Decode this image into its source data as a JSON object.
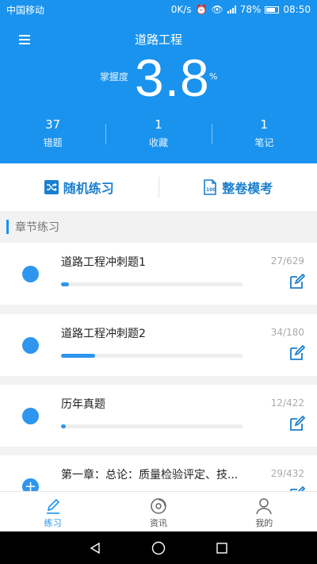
{
  "status_bar": {
    "carrier": "中国移动",
    "speed": "0K/s",
    "battery": "78%",
    "time": "08:50"
  },
  "header": {
    "title": "道路工程",
    "mastery_label": "掌握度",
    "mastery_value": "3.8",
    "mastery_unit": "%",
    "stats": [
      {
        "value": "37",
        "label": "错题"
      },
      {
        "value": "1",
        "label": "收藏"
      },
      {
        "value": "1",
        "label": "笔记"
      }
    ]
  },
  "quick_actions": {
    "random_label": "随机练习",
    "exam_label": "整卷模考"
  },
  "section": {
    "title": "章节练习"
  },
  "chapters": [
    {
      "title": "道路工程冲刺题1",
      "count": "27/629",
      "progress": 0.043,
      "marker": ""
    },
    {
      "title": "道路工程冲刺题2",
      "count": "34/180",
      "progress": 0.189,
      "marker": ""
    },
    {
      "title": "历年真题",
      "count": "12/422",
      "progress": 0.028,
      "marker": ""
    },
    {
      "title": "第一章：总论：质量检验评定、技...",
      "count": "29/432",
      "progress": 0.067,
      "marker": "+"
    }
  ],
  "bottom_nav": [
    {
      "label": "练习",
      "active": true
    },
    {
      "label": "资讯",
      "active": false
    },
    {
      "label": "我的",
      "active": false
    }
  ],
  "colors": {
    "primary": "#1a93ee",
    "accent_text": "#1a7fcf",
    "background": "#f2f2f2"
  }
}
